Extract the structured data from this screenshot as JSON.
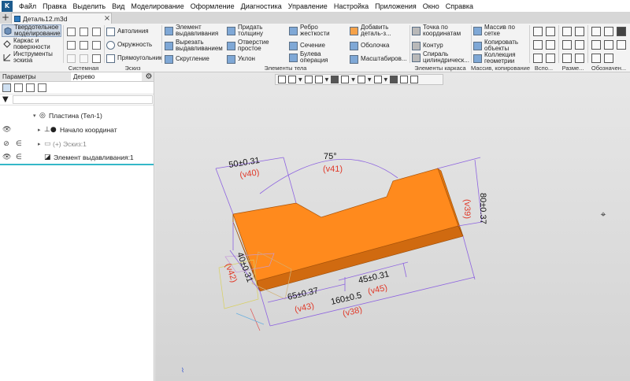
{
  "menubar": {
    "logo": "K",
    "items": [
      "Файл",
      "Правка",
      "Выделить",
      "Вид",
      "Моделирование",
      "Оформление",
      "Диагностика",
      "Управление",
      "Настройка",
      "Приложения",
      "Окно",
      "Справка"
    ]
  },
  "tabs": {
    "add": "+",
    "document": "Деталь12.m3d",
    "close": "×"
  },
  "ribbon": {
    "modes": [
      "Твердотельное моделирование",
      "Каркас и поверхности",
      "Инструменты эскиза"
    ],
    "sketch": {
      "autoline": "Автолиния",
      "circle": "Окружность",
      "rectangle": "Прямоугольник"
    },
    "solid": {
      "extrude": "Элемент выдавливания",
      "cut_extrude": "Вырезать выдавливанием",
      "fillet": "Скругление",
      "thicken": "Придать толщину",
      "simple_hole": "Отверстие простое",
      "slope": "Уклон",
      "rib": "Ребро жесткости",
      "section": "Сечение",
      "boolean": "Булева операция",
      "add_part": "Добавить деталь-з...",
      "shell": "Оболочка",
      "scale": "Масштабиров..."
    },
    "wireframe": {
      "point": "Точка по координатам",
      "contour": "Контур",
      "spiral": "Спираль цилиндрическ..."
    },
    "arrays": {
      "grid_array": "Массив по сетке",
      "copy_objects": "Копировать объекты",
      "geometry_collection": "Коллекция геометрии"
    },
    "groups": {
      "system": "Системная",
      "sketch": "Эскиз",
      "solid_elements": "Элементы тела",
      "wireframe_elements": "Элементы каркаса",
      "arrays_copy": "Массив, копирование",
      "aux": "Вспо...",
      "dimensions": "Разме...",
      "designations": "Обозначен..."
    }
  },
  "panel": {
    "tab_params": "Параметры",
    "tab_tree": "Дерево",
    "gear": "⚙",
    "filter": "▼",
    "search_placeholder": "",
    "search_glyph": "⌕",
    "tree": [
      {
        "label": "Пластина (Тел-1)",
        "expander": "▾",
        "icon": "◎"
      },
      {
        "label": "Начало координат",
        "vis": "👁",
        "expander": "▸",
        "icon": "⊥●"
      },
      {
        "label": "Эскиз:1",
        "prefix": "(+)",
        "vis": "⊘",
        "dep": "∈",
        "expander": "▸",
        "icon": "▭"
      },
      {
        "label": "Элемент выдавливания:1",
        "vis": "👁",
        "dep": "∈",
        "icon": "◪"
      }
    ]
  },
  "viewport": {
    "crosshair": "⌖",
    "axis_mark": "⌇",
    "dimensions": {
      "d40": "50±0.31",
      "v40": "(v40)",
      "angle": "75°",
      "v41": "(v41)",
      "d39": "80±0.37",
      "v39": "(v39)",
      "d42": "40±0.31",
      "v42": "(v42)",
      "d43": "65±0.37",
      "v43": "(v43)",
      "d45": "45±0.31",
      "v45": "(v45)",
      "d38": "160±0.5",
      "v38": "(v38)"
    },
    "colors": {
      "part_top": "#ff8a1d",
      "part_front": "#d66a0c",
      "part_side": "#e8780f",
      "dimension_line": "#8d63e0",
      "variable_text": "#e03a2a"
    }
  }
}
